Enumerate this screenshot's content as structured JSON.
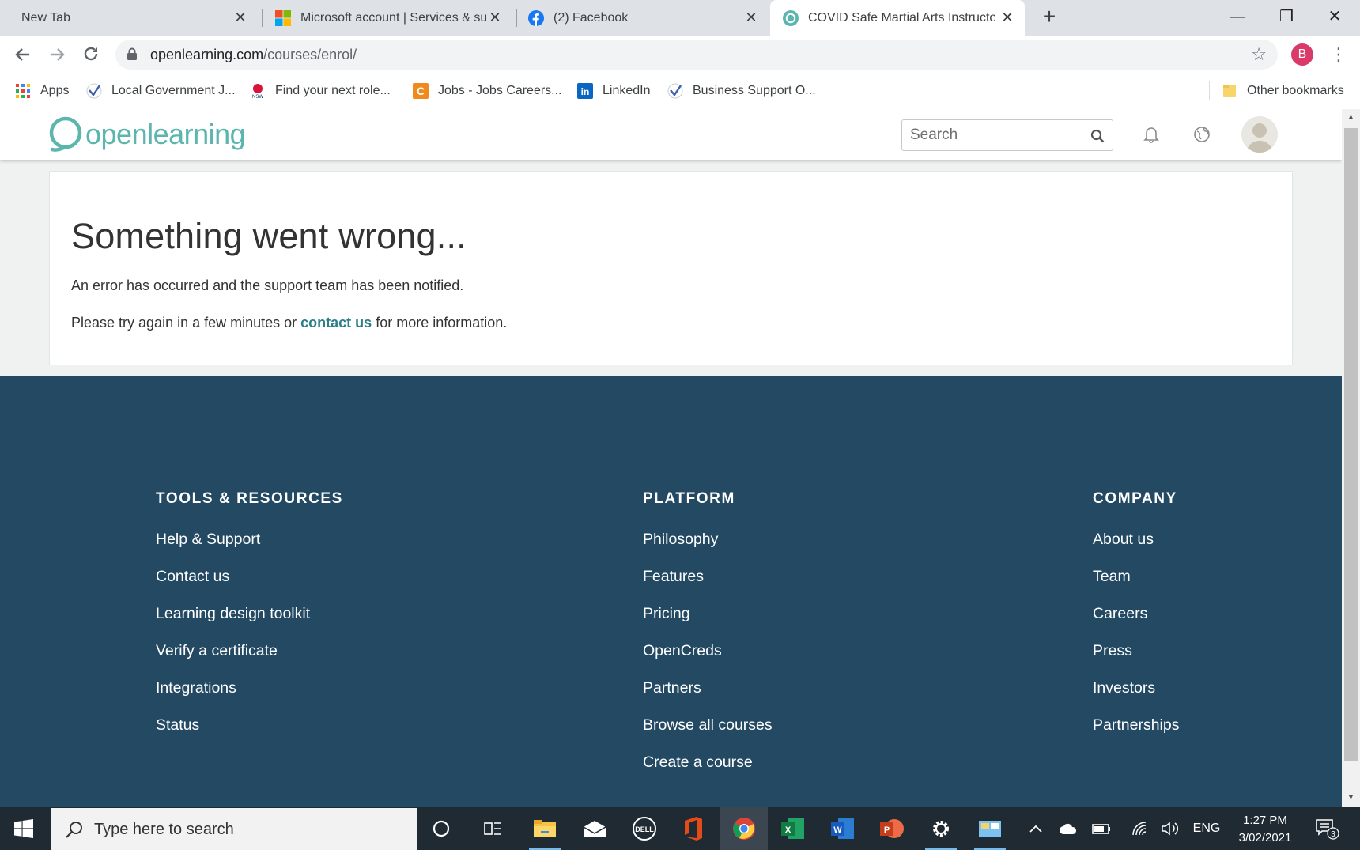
{
  "browser": {
    "tabs": [
      {
        "title": "New Tab",
        "icon": "none"
      },
      {
        "title": "Microsoft account | Services & su",
        "icon": "microsoft-icon"
      },
      {
        "title": "(2) Facebook",
        "icon": "facebook-icon"
      },
      {
        "title": "COVID Safe Martial Arts Instructo",
        "icon": "openlearning-icon",
        "active": true
      }
    ],
    "new_tab_symbol": "+",
    "close_symbol": "✕",
    "window_controls": {
      "minimize": "—",
      "restore": "❐",
      "close": "✕"
    },
    "url_host": "openlearning.com",
    "url_path": "/courses/enrol/",
    "profile_initial": "B",
    "menu_symbol": "⋮",
    "bookmarks": [
      {
        "label": "Apps",
        "icon": "apps-grid-icon"
      },
      {
        "label": "Local Government J...",
        "icon": "check-icon"
      },
      {
        "label": "Find your next role...",
        "icon": "nsw-waratah-icon"
      },
      {
        "label": "Jobs - Jobs Careers...",
        "icon": "careers-icon"
      },
      {
        "label": "LinkedIn",
        "icon": "linkedin-icon"
      },
      {
        "label": "Business Support O...",
        "icon": "check-icon"
      }
    ],
    "other_bookmarks": "Other bookmarks"
  },
  "site": {
    "brand": "openlearning",
    "brand_color": "#5bb6ad",
    "search_placeholder": "Search"
  },
  "error": {
    "heading": "Something went wrong...",
    "message": "An error has occurred and the support team has been notified.",
    "retry_prefix": "Please try again in a few minutes or ",
    "contact_link": "contact us",
    "retry_suffix": " for more information."
  },
  "footer": {
    "background_color": "#234963",
    "columns": [
      {
        "heading": "TOOLS & RESOURCES",
        "links": [
          "Help & Support",
          "Contact us",
          "Learning design toolkit",
          "Verify a certificate",
          "Integrations",
          "Status"
        ]
      },
      {
        "heading": "PLATFORM",
        "links": [
          "Philosophy",
          "Features",
          "Pricing",
          "OpenCreds",
          "Partners",
          "Browse all courses",
          "Create a course"
        ]
      },
      {
        "heading": "COMPANY",
        "links": [
          "About us",
          "Team",
          "Careers",
          "Press",
          "Investors",
          "Partnerships"
        ]
      }
    ]
  },
  "taskbar": {
    "search_placeholder": "Type here to search",
    "language": "ENG",
    "time": "1:27 PM",
    "date": "3/02/2021",
    "notification_count": "3"
  }
}
